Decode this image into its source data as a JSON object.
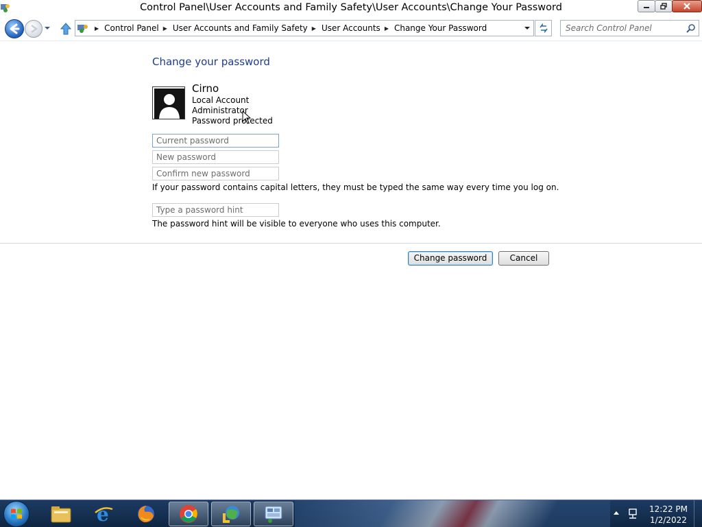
{
  "window": {
    "title": "Control Panel\\User Accounts and Family Safety\\User Accounts\\Change Your Password"
  },
  "navbar": {
    "breadcrumbs": [
      "Control Panel",
      "User Accounts and Family Safety",
      "User Accounts",
      "Change Your Password"
    ],
    "search_placeholder": "Search Control Panel"
  },
  "content": {
    "page_title": "Change your password",
    "user": {
      "name": "Cirno",
      "account_type": "Local Account",
      "role": "Administrator",
      "status": "Password protected"
    },
    "fields": {
      "current_password_placeholder": "Current password",
      "new_password_placeholder": "New password",
      "confirm_password_placeholder": "Confirm new password",
      "hint_placeholder": "Type a password hint"
    },
    "capital_letters_note": "If your password contains capital letters, they must be typed the same way every time you log on.",
    "hint_note": "The password hint will be visible to everyone who uses this computer.",
    "buttons": {
      "change_password": "Change password",
      "cancel": "Cancel"
    }
  },
  "taskbar": {
    "pinned": [
      "file-explorer-icon",
      "internet-explorer-icon",
      "firefox-icon",
      "chrome-icon",
      "download-manager-icon",
      "control-panel-icon"
    ],
    "clock_time": "12:22 PM",
    "clock_date": "1/2/2022"
  },
  "colors": {
    "title_blue": "#1e3c8c",
    "taskbar": "#1c3b62",
    "button_focus": "#3c7fb1"
  }
}
